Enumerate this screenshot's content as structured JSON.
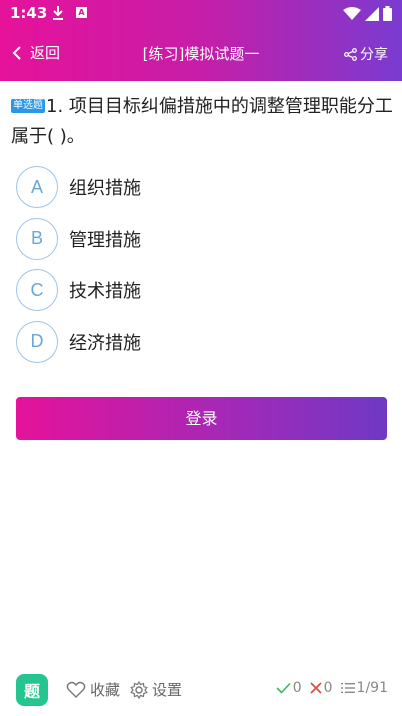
{
  "status": {
    "time": "1:43"
  },
  "header": {
    "back_label": "返回",
    "title": "[练习]模拟试题一",
    "share_label": "分享"
  },
  "question": {
    "badge": "单选题",
    "text": "1. 项目目标纠偏措施中的调整管理职能分工属于( )。"
  },
  "options": [
    {
      "letter": "A",
      "text": "组织措施"
    },
    {
      "letter": "B",
      "text": "管理措施"
    },
    {
      "letter": "C",
      "text": "技术措施"
    },
    {
      "letter": "D",
      "text": "经济措施"
    }
  ],
  "login_label": "登录",
  "bottom": {
    "app_icon_char": "题",
    "favorite_label": "收藏",
    "settings_label": "设置",
    "correct_count": "0",
    "wrong_count": "0",
    "progress": "1/91"
  },
  "colors": {
    "accent_start": "#e6129a",
    "accent_end": "#7a3bd0",
    "option_circle": "#6aa7d9",
    "correct": "#3bb85a",
    "wrong": "#e0463a",
    "badge": "#2a97e8"
  }
}
